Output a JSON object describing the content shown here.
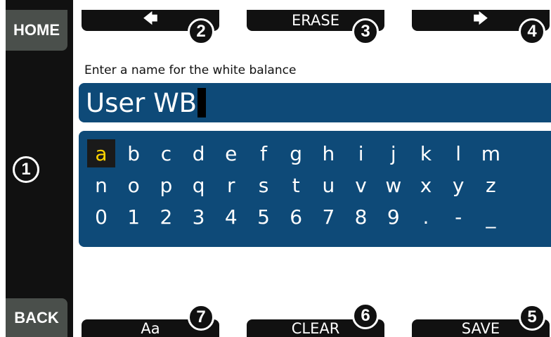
{
  "sidebar": {
    "home_label": "HOME",
    "back_label": "BACK"
  },
  "softkeys": {
    "left_arrow": "🡄",
    "erase": "ERASE",
    "right_arrow": "🡆",
    "case_toggle": "Aa",
    "clear": "CLEAR",
    "save": "SAVE"
  },
  "callouts": [
    "1",
    "2",
    "3",
    "4",
    "5",
    "6",
    "7"
  ],
  "prompt": "Enter a name for the white balance",
  "name_field": {
    "value": "User WB"
  },
  "keyboard": {
    "selected": "a",
    "rows": [
      [
        "a",
        "b",
        "c",
        "d",
        "e",
        "f",
        "g",
        "h",
        "i",
        "j",
        "k",
        "l",
        "m"
      ],
      [
        "n",
        "o",
        "p",
        "q",
        "r",
        "s",
        "t",
        "u",
        "v",
        "w",
        "x",
        "y",
        "z"
      ],
      [
        "0",
        "1",
        "2",
        "3",
        "4",
        "5",
        "6",
        "7",
        "8",
        "9",
        ".",
        "-",
        "_"
      ]
    ]
  }
}
